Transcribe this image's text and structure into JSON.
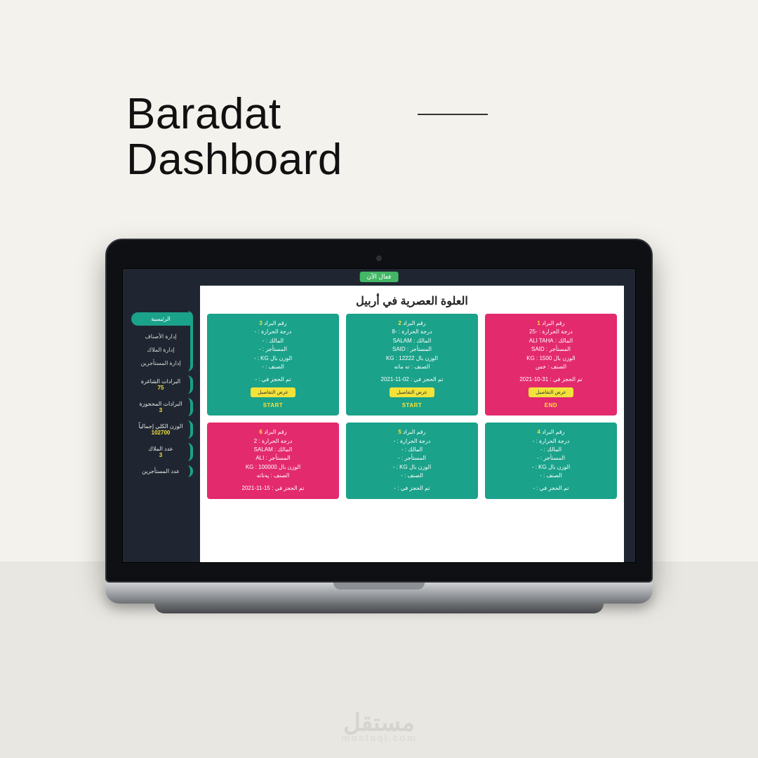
{
  "page": {
    "title_line1": "Baradat",
    "title_line2": "Dashboard"
  },
  "watermark": {
    "ar": "مستقل",
    "lat": "mostaql.com"
  },
  "header_tag": "فعال الآن",
  "board_title": "العلوة العصرية في أربيل",
  "labels": {
    "card_no": "رقم البراد",
    "temp": "درجة الحرارة :",
    "owner": "المالك :",
    "tenant": "المستأجر :",
    "weight": "الوزن بال KG :",
    "type": "الصنف :",
    "booked": "تم الحجز في :",
    "details_btn": "عرض التفاصيل"
  },
  "cards": [
    {
      "n": "1",
      "temp": "-25",
      "owner": "ALI TAHA",
      "tenant": "SAID",
      "weight": "1500",
      "type": "خس",
      "booked": "31-10-2021",
      "action": "END",
      "color": "pink"
    },
    {
      "n": "2",
      "temp": "-8",
      "owner": "SALAM",
      "tenant": "SAID",
      "weight": "12222",
      "type": "ته ماته",
      "booked": "02-11-2021",
      "action": "START",
      "color": "teal"
    },
    {
      "n": "3",
      "temp": "-",
      "owner": "-",
      "tenant": "-",
      "weight": "-",
      "type": "-",
      "booked": "-",
      "action": "START",
      "color": "teal"
    },
    {
      "n": "4",
      "temp": "-",
      "owner": "-",
      "tenant": "-",
      "weight": "-",
      "type": "-",
      "booked": "-",
      "action": "",
      "color": "teal"
    },
    {
      "n": "5",
      "temp": "-",
      "owner": "-",
      "tenant": "-",
      "weight": "-",
      "type": "-",
      "booked": "-",
      "action": "",
      "color": "teal"
    },
    {
      "n": "6",
      "temp": "2",
      "owner": "SALAM",
      "tenant": "ALI",
      "weight": "100000",
      "type": "پەتاتە",
      "booked": "15-11-2021",
      "action": "",
      "color": "pink"
    }
  ],
  "sidebar": {
    "nav": [
      "الرئيسية",
      "إدارة الأصناف",
      "إدارة الملاك",
      "إدارة المستأجرين"
    ],
    "stats": [
      {
        "label": "البرادات الشاغرة",
        "value": "75"
      },
      {
        "label": "البرادات المحجوزة",
        "value": "3"
      },
      {
        "label": "الوزن الكلي إجمالياً",
        "value": "102700"
      },
      {
        "label": "عدد الملاك",
        "value": "3"
      },
      {
        "label": "عدد المستأجرين",
        "value": ""
      }
    ]
  }
}
